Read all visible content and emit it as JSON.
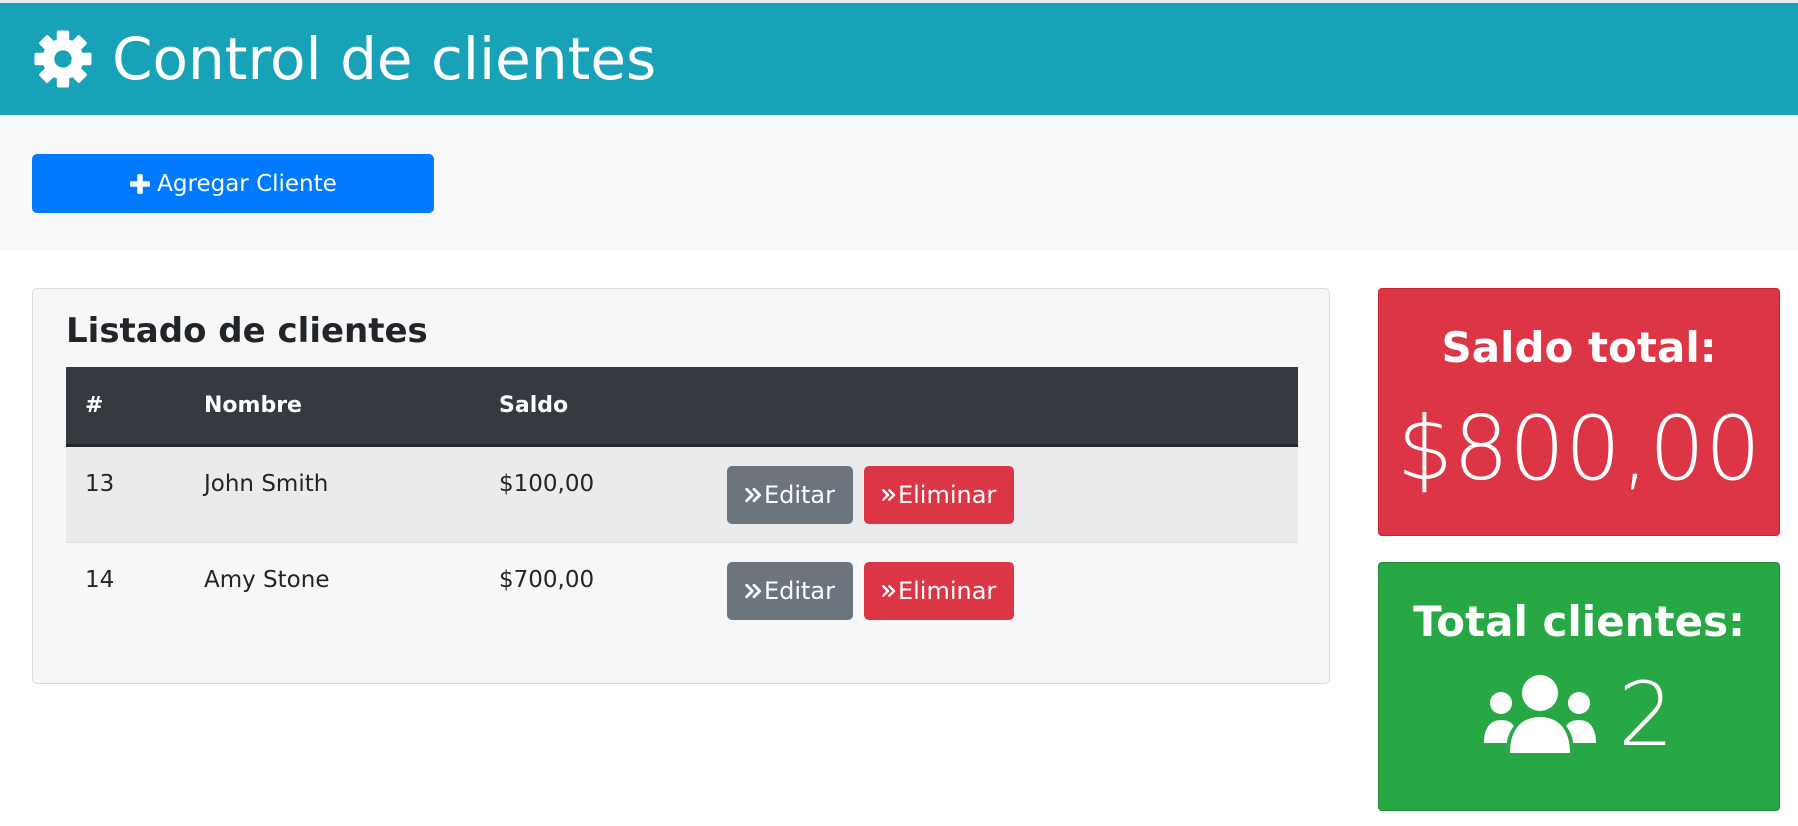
{
  "header": {
    "title": "Control de clientes",
    "icon": "gear-icon"
  },
  "toolbar": {
    "add_label": "Agregar Cliente",
    "add_icon": "plus-icon"
  },
  "list": {
    "title": "Listado de clientes",
    "columns": [
      "#",
      "Nombre",
      "Saldo",
      ""
    ],
    "rows": [
      {
        "id": "13",
        "name": "John Smith",
        "saldo": "$100,00",
        "edit": "Editar",
        "delete": "Eliminar"
      },
      {
        "id": "14",
        "name": "Amy Stone",
        "saldo": "$700,00",
        "edit": "Editar",
        "delete": "Eliminar"
      }
    ]
  },
  "summary": {
    "saldo_title": "Saldo total:",
    "saldo_value": "$800,00",
    "clientes_title": "Total clientes:",
    "clientes_value": "2",
    "clientes_icon": "users-icon"
  },
  "colors": {
    "header": "#17a2b8",
    "primary": "#007bff",
    "danger": "#dc3545",
    "success": "#28a745",
    "secondary": "#6c757d",
    "dark": "#343a40"
  }
}
